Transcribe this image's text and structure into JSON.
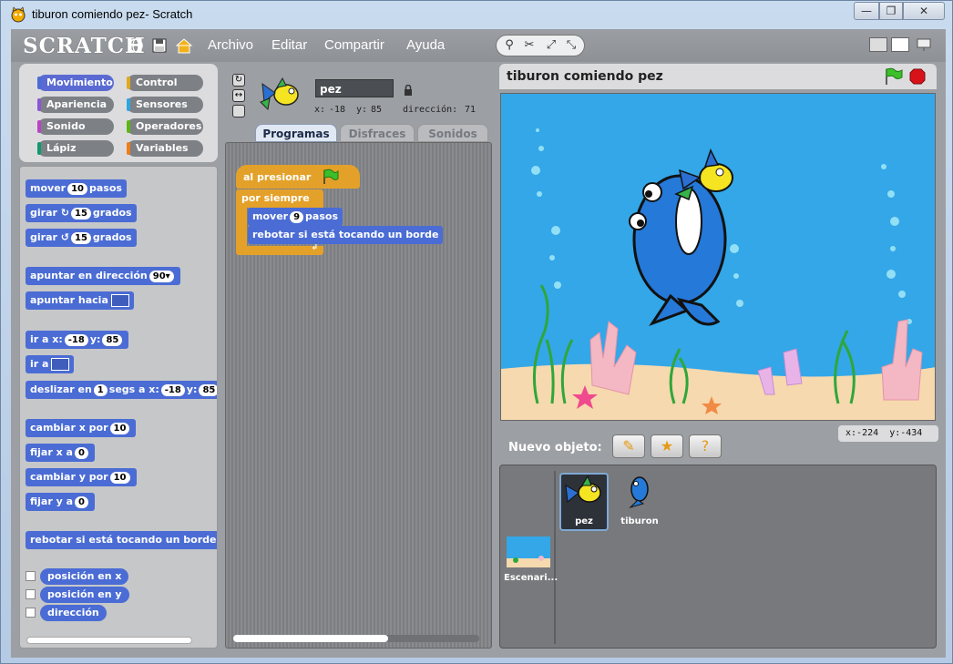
{
  "window": {
    "title": "tiburon comiendo pez- Scratch",
    "min": "—",
    "max": "❐",
    "close": "✕"
  },
  "menubar": {
    "logo": "SCRATCH",
    "menus": [
      "Archivo",
      "Editar",
      "Compartir",
      "Ayuda"
    ]
  },
  "categories": [
    {
      "label": "Movimiento",
      "color": "#4a6cd4"
    },
    {
      "label": "Control",
      "color": "#e1a91a"
    },
    {
      "label": "Apariencia",
      "color": "#8a55d7"
    },
    {
      "label": "Sensores",
      "color": "#2ca5e2"
    },
    {
      "label": "Sonido",
      "color": "#bb42c3"
    },
    {
      "label": "Operadores",
      "color": "#5cb712"
    },
    {
      "label": "Lápiz",
      "color": "#0e9a6c"
    },
    {
      "label": "Variables",
      "color": "#ee7d16"
    }
  ],
  "palette": {
    "move": {
      "a": "mover",
      "v": "10",
      "b": "pasos"
    },
    "turn_right": {
      "a": "girar",
      "v": "15",
      "b": "grados"
    },
    "turn_left": {
      "a": "girar",
      "v": "15",
      "b": "grados"
    },
    "point_dir": {
      "a": "apuntar en dirección",
      "v": "90▾"
    },
    "point_towards": {
      "a": "apuntar hacia"
    },
    "goto_xy": {
      "a": "ir a x:",
      "x": "-18",
      "b": "y:",
      "y": "85"
    },
    "goto": {
      "a": "ir a"
    },
    "glide": {
      "a": "deslizar en",
      "s": "1",
      "b": "segs a x:",
      "x": "-18",
      "c": "y:",
      "y": "85"
    },
    "change_x": {
      "a": "cambiar x por",
      "v": "10"
    },
    "set_x": {
      "a": "fijar x a",
      "v": "0"
    },
    "change_y": {
      "a": "cambiar y por",
      "v": "10"
    },
    "set_y": {
      "a": "fijar y a",
      "v": "0"
    },
    "bounce": "rebotar si está tocando un borde",
    "reporters": [
      "posición en x",
      "posición en y",
      "dirección"
    ]
  },
  "sprite": {
    "name": "pez",
    "x_label": "x:",
    "x": "-18",
    "y_label": "y:",
    "y": "85",
    "dir_label": "dirección:",
    "dir": "71"
  },
  "tabs": [
    "Programas",
    "Disfraces",
    "Sonidos"
  ],
  "script": {
    "hat": "al presionar",
    "forever": "por siempre",
    "move_a": "mover",
    "move_v": "9",
    "move_b": "pasos",
    "bounce": "rebotar si está tocando un borde"
  },
  "stage": {
    "title": "tiburon comiendo pez",
    "mouse_x_label": "x:",
    "mouse_x": "-224",
    "mouse_y_label": "y:",
    "mouse_y": "-434",
    "sky": "#33a7e8",
    "sand": "#f6d9ae"
  },
  "new_object": {
    "label": "Nuevo objeto:"
  },
  "sprites": [
    {
      "name": "pez",
      "selected": true
    },
    {
      "name": "tiburon",
      "selected": false
    }
  ],
  "stage_thumb": {
    "name": "Escenari..."
  }
}
